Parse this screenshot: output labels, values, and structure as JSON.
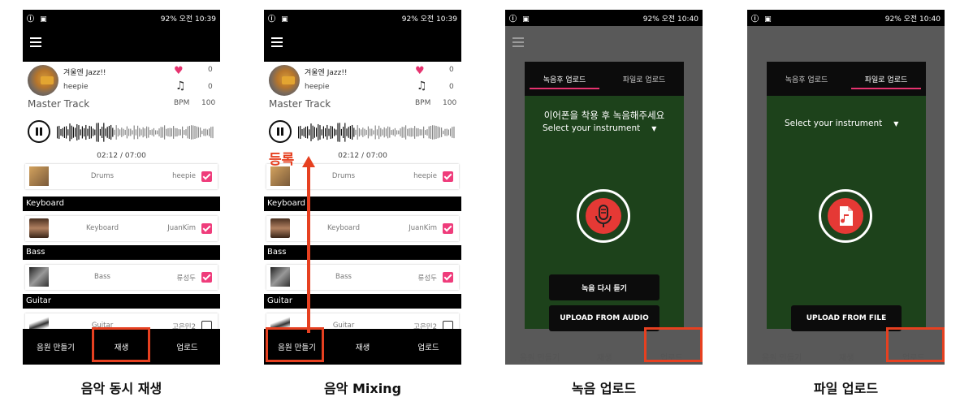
{
  "status": {
    "left_icons": "ⓘ ▣",
    "right_text": "92% 오전 10:39",
    "right_text2": "92% 오전 10:40"
  },
  "header": {
    "title": "겨울엔 Jazz!!",
    "user": "heepie",
    "track": "Master Track",
    "likes": "0",
    "notes": "0",
    "bpm_label": "BPM",
    "bpm": "100",
    "time": "02:12 / 07:00"
  },
  "list": {
    "rows": [
      {
        "instrument": "Drums",
        "by": "heepie",
        "checked": true
      },
      {
        "instrument": "Keyboard",
        "by": "JuanKim",
        "checked": true
      },
      {
        "instrument": "Bass",
        "by": "류성두",
        "checked": true
      },
      {
        "instrument": "Guitar",
        "by": "고은민2",
        "checked": false
      }
    ],
    "sections": [
      "Keyboard",
      "Bass",
      "Guitar"
    ]
  },
  "bottom_nav": {
    "make": "음원 만들기",
    "play": "재생",
    "upload": "업로드"
  },
  "annotation": {
    "register": "등록"
  },
  "dialog_record": {
    "tab_record": "녹음후 업로드",
    "tab_file": "파일로 업로드",
    "instruction": "이어폰을 착용 후 녹음해주세요",
    "select": "Select your instrument",
    "replay": "녹음 다시 듣기",
    "upload_audio": "UPLOAD FROM AUDIO"
  },
  "dialog_file": {
    "tab_record": "녹음후 업로드",
    "tab_file": "파일로 업로드",
    "select": "Select your instrument",
    "upload_file": "UPLOAD FROM FILE"
  },
  "captions": [
    "음악 동시 재생",
    "음악 Mixing",
    "녹음 업로드",
    "파일 업로드"
  ],
  "colors": {
    "accent": "#ef3c7b",
    "highlight": "#e64020",
    "dialog_bg": "#1d421b",
    "record": "#e53935"
  }
}
